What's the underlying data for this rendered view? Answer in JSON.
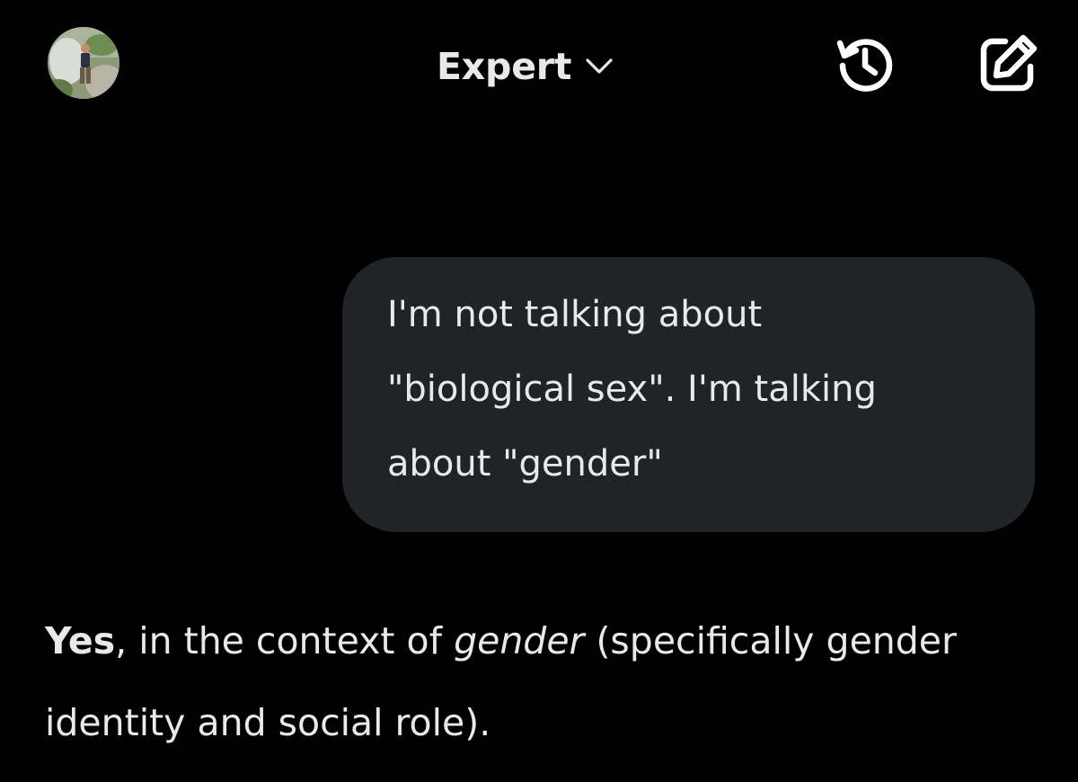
{
  "header": {
    "mode_label": "Expert",
    "avatar_icon": "user-avatar-photo",
    "history_icon": "history-icon",
    "compose_icon": "new-chat-icon",
    "chevron_icon": "chevron-down-icon"
  },
  "conversation": {
    "user_message": {
      "lines": [
        "I'm not talking about",
        "\"biological sex\". I'm talking",
        "about \"gender\""
      ]
    },
    "assistant_message": {
      "bold_lead": "Yes",
      "text_part1": ", in the context of ",
      "italic_term": "gender",
      "text_part2": " (specifically gender identity and social role)."
    }
  },
  "colors": {
    "background": "#000000",
    "text": "#e7e9ea",
    "bubble": "#202327"
  }
}
